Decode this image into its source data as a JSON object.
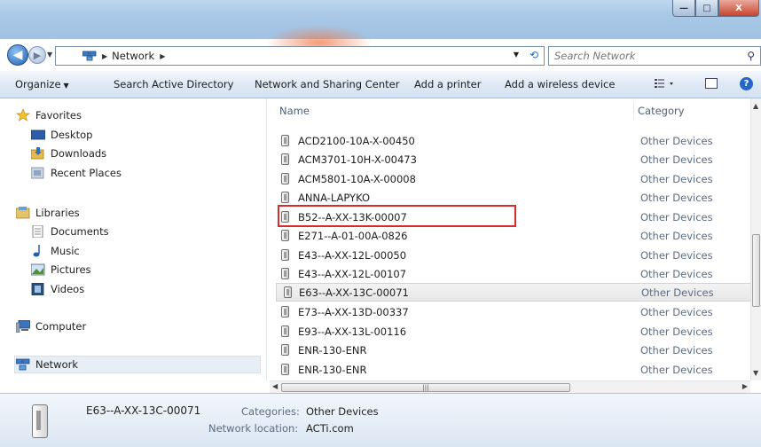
{
  "window": {
    "minimize_glyph": "—",
    "maximize_glyph": "□",
    "close_glyph": "X"
  },
  "address": {
    "crumbs": [
      "Network"
    ],
    "search_placeholder": "Search Network"
  },
  "toolbar": {
    "organize": "Organize",
    "search_ad": "Search Active Directory",
    "network_sharing": "Network and Sharing Center",
    "add_printer": "Add a printer",
    "add_wireless": "Add a wireless device"
  },
  "nav": {
    "favorites": "Favorites",
    "desktop": "Desktop",
    "downloads": "Downloads",
    "recent_places": "Recent Places",
    "libraries": "Libraries",
    "documents": "Documents",
    "music": "Music",
    "pictures": "Pictures",
    "videos": "Videos",
    "computer": "Computer",
    "network": "Network"
  },
  "list": {
    "col_name": "Name",
    "col_category": "Category",
    "rows": [
      {
        "name": "ACD2100-10A-X-00450",
        "category": "Other Devices"
      },
      {
        "name": "ACM3701-10H-X-00473",
        "category": "Other Devices"
      },
      {
        "name": "ACM5801-10A-X-00008",
        "category": "Other Devices"
      },
      {
        "name": "ANNA-LAPYKO",
        "category": "Other Devices"
      },
      {
        "name": "B52--A-XX-13K-00007",
        "category": "Other Devices"
      },
      {
        "name": "E271--A-01-00A-0826",
        "category": "Other Devices"
      },
      {
        "name": "E43--A-XX-12L-00050",
        "category": "Other Devices"
      },
      {
        "name": "E43--A-XX-12L-00107",
        "category": "Other Devices"
      },
      {
        "name": "E63--A-XX-13C-00071",
        "category": "Other Devices"
      },
      {
        "name": "E73--A-XX-13D-00337",
        "category": "Other Devices"
      },
      {
        "name": "E93--A-XX-13L-00116",
        "category": "Other Devices"
      },
      {
        "name": "ENR-130-ENR",
        "category": "Other Devices"
      },
      {
        "name": "ENR-130-ENR",
        "category": "Other Devices"
      }
    ]
  },
  "details": {
    "name": "E63--A-XX-13C-00071",
    "categories_label": "Categories:",
    "categories_value": "Other Devices",
    "location_label": "Network location:",
    "location_value": "ACTi.com"
  }
}
